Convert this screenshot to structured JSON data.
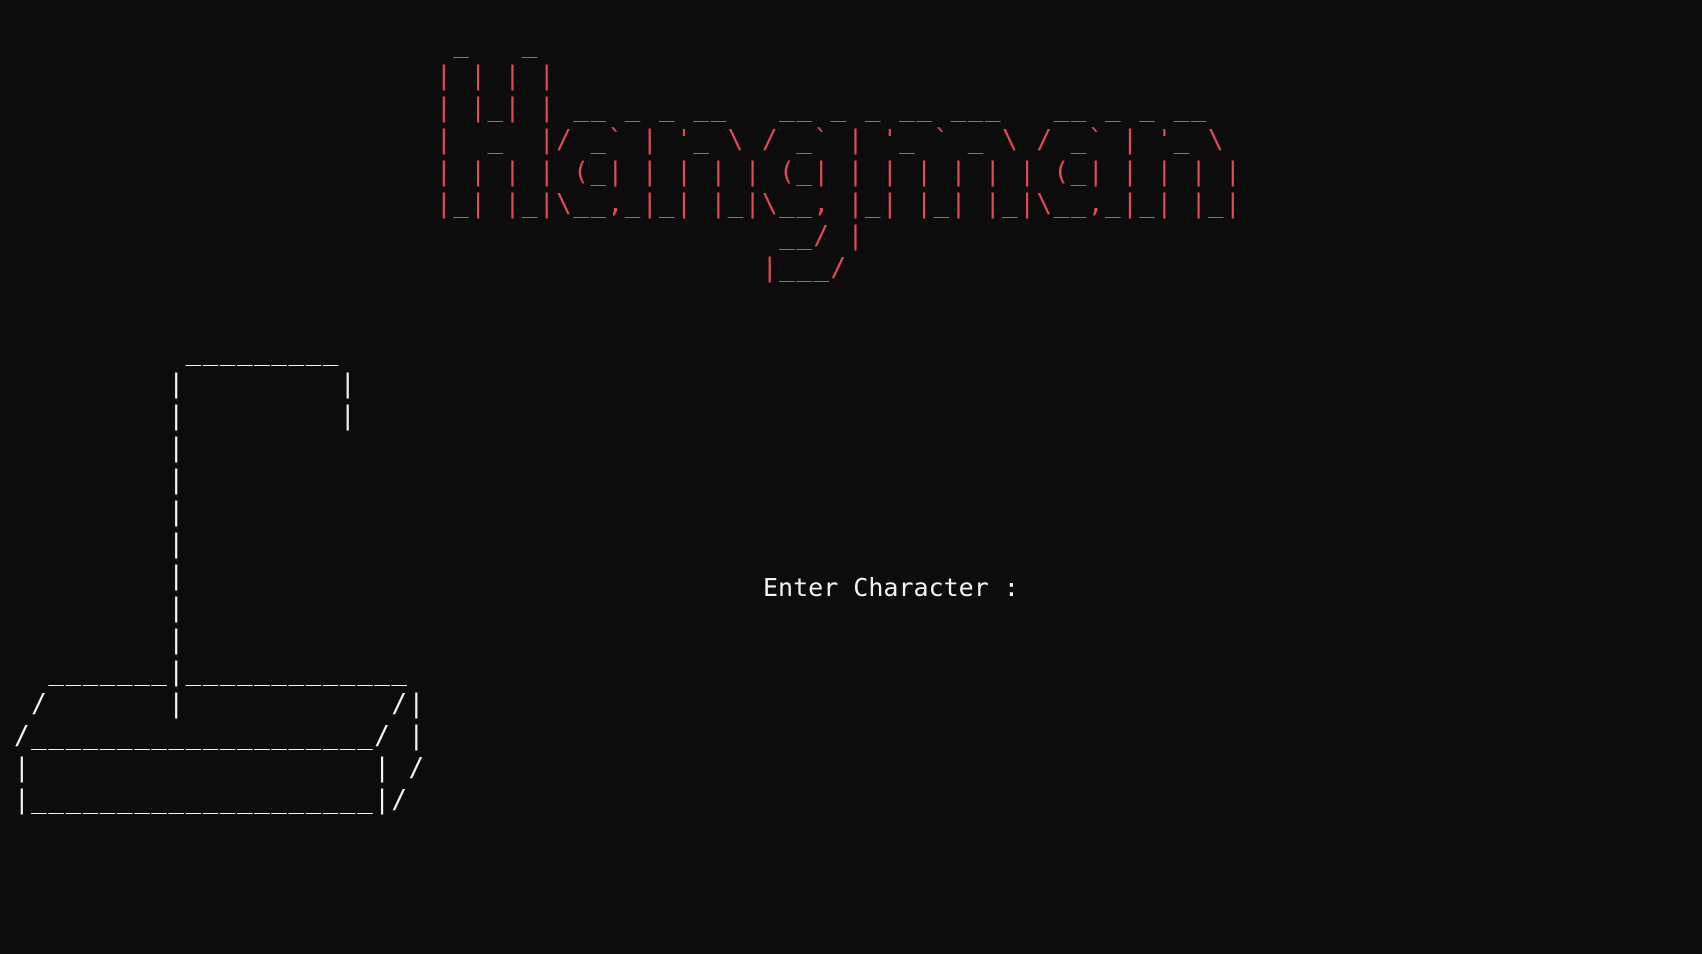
{
  "title_art": " _   _\n| | | |\n| |_| | __ _ _ __   __ _ _ __ ___   __ _ _ __\n|  _  |/ _` | '_ \\ / _` | '_ ` _ \\ / _` | '_ \\\n| | | | (_| | | | | (_| | | | | | | (_| | | | |\n|_| |_|\\__,_|_| |_|\\__, |_| |_| |_|\\__,_|_| |_|\n                    __/ |\n                   |___/",
  "gallows_art": "          _________\n         |         |\n         |         |\n         |\n         |\n         |\n         |\n         |\n         |\n         |\n  _______|_____________\n /       |            /|\n/____________________/ |\n|                    | /\n|____________________|/",
  "prompt_text": "Enter Character :",
  "colors": {
    "background": "#0c0c0c",
    "title_text": "#e74856",
    "text": "#f2f2f2"
  }
}
